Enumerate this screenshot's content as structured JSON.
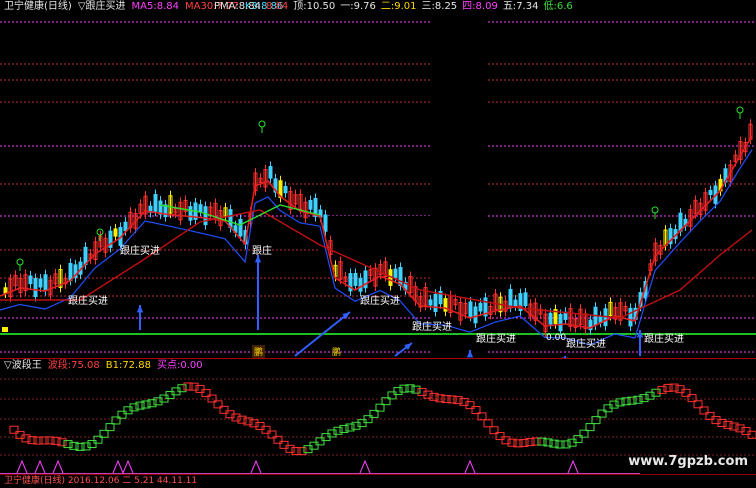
{
  "main_header": {
    "title": "卫宁健康(日线)",
    "indicator_name": "▽跟庄买进",
    "ma5_label": "MA5:",
    "ma5_value": "8.84",
    "ma30_label": "MA30:",
    "ma30_value": "7.77",
    "k_label": "K3:",
    "k_value": "8.86",
    "pma_label": "PMA:",
    "pma_value": "8.84",
    "pma_value2": "8.84",
    "p1_label": "顶:",
    "p1_value": "10.50",
    "p2_label": "一:",
    "p2_value": "9.76",
    "p3_label": "二:",
    "p3_value": "9.01",
    "p4_label": "三:",
    "p4_value": "8.25",
    "p5_label": "四:",
    "p5_value": "8.09",
    "p6_label": "五:",
    "p6_value": "7.34",
    "p7_label": "低:",
    "p7_value": "6.6"
  },
  "buy_labels": [
    "跟庄买进",
    "跟庄买进",
    "跟庄",
    "跟庄买进",
    "跟庄买进",
    "跟庄买进",
    "跟庄买进",
    "跟庄买进"
  ],
  "sell_label": "0.00",
  "bottom_marker": "鹏",
  "osc_header": {
    "name": "▽波段王",
    "wave_label": "波段:",
    "wave_value": "75.08",
    "b1_label": "B1:",
    "b1_value": "72.88",
    "buy_label": "买点:",
    "buy_value": "0.00"
  },
  "footer": {
    "text": "卫宁健康(日线)  2016.12.06 二 5.21 44.11.11"
  },
  "watermark": "www.7gpzb.com",
  "colors": {
    "up": "#ff3030",
    "down": "#40d0ff",
    "yellow": "#ffee00",
    "ma_red": "#e02020",
    "ma_blue": "#2050ff",
    "ma_dark": "#c01010",
    "level_line": "#ff40ff",
    "support_line": "#20c020",
    "arrow": "#3060ff"
  }
}
